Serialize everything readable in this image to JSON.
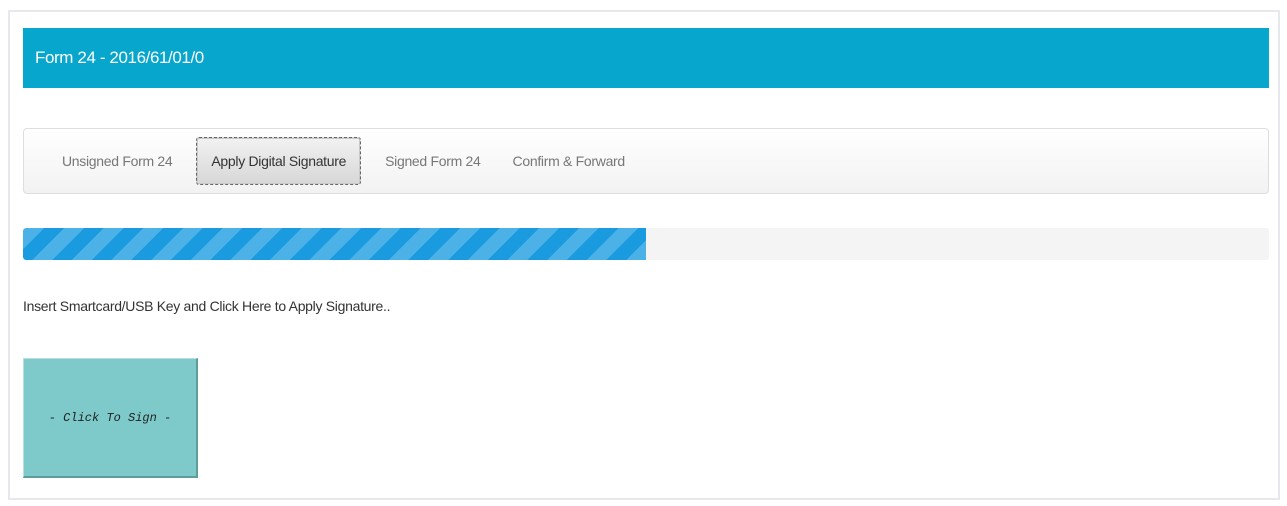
{
  "header": {
    "title": "Form 24 - 2016/61/01/0"
  },
  "tabs": [
    {
      "label": "Unsigned Form 24",
      "active": false
    },
    {
      "label": "Apply Digital Signature",
      "active": true
    },
    {
      "label": "Signed Form 24",
      "active": false
    },
    {
      "label": "Confirm & Forward",
      "active": false
    }
  ],
  "progress": {
    "percent": 50,
    "color": "#1a9be0"
  },
  "instruction": "Insert Smartcard/USB Key and Click Here to Apply Signature..",
  "sign_button": {
    "label": "- Click To Sign -",
    "color": "#7ec9c9"
  },
  "colors": {
    "header_bg": "#07a6cc"
  }
}
